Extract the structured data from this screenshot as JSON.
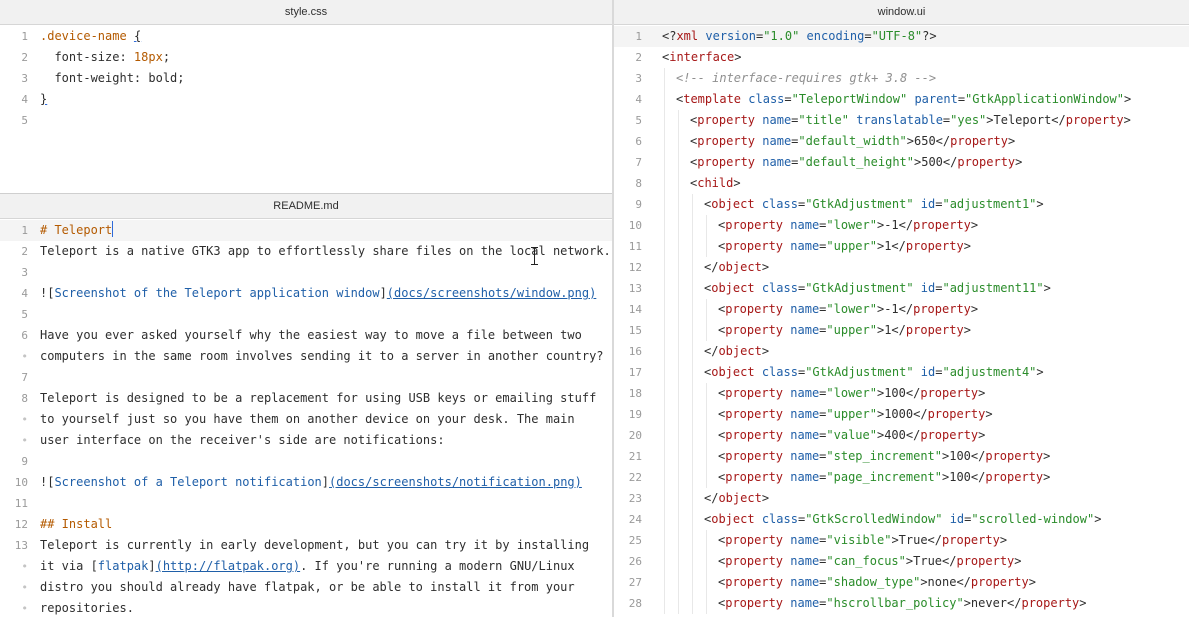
{
  "panes": {
    "css": {
      "title": "style.css"
    },
    "readme": {
      "title": "README.md"
    },
    "ui": {
      "title": "window.ui"
    }
  },
  "css_lines": [
    {
      "n": "1",
      "parts": [
        {
          "t": ".device-name",
          "c": "c-sel"
        },
        {
          "t": " "
        },
        {
          "t": "{",
          "c": "c-ul"
        }
      ]
    },
    {
      "n": "2",
      "parts": [
        {
          "t": "  font-size: "
        },
        {
          "t": "18px",
          "c": "c-num"
        },
        {
          "t": ";"
        }
      ]
    },
    {
      "n": "3",
      "parts": [
        {
          "t": "  font-weight: bold;"
        }
      ]
    },
    {
      "n": "4",
      "parts": [
        {
          "t": "}",
          "c": "c-ul"
        }
      ]
    },
    {
      "n": "5",
      "parts": [
        {
          "t": ""
        }
      ]
    }
  ],
  "readme_lines": [
    {
      "n": "1",
      "current": true,
      "caret": true,
      "parts": [
        {
          "t": "# Teleport",
          "c": "c-head"
        }
      ]
    },
    {
      "n": "2",
      "parts": [
        {
          "t": "Teleport is a native GTK3 app to effortlessly share files on the local network."
        }
      ]
    },
    {
      "n": "3",
      "parts": [
        {
          "t": ""
        }
      ]
    },
    {
      "n": "4",
      "parts": [
        {
          "t": "!["
        },
        {
          "t": "Screenshot of the Teleport application window",
          "c": "c-link"
        },
        {
          "t": "]"
        },
        {
          "t": "(docs/screenshots/window.png)",
          "c": "c-url"
        }
      ]
    },
    {
      "n": "5",
      "parts": [
        {
          "t": ""
        }
      ]
    },
    {
      "n": "6",
      "parts": [
        {
          "t": "Have you ever asked yourself why the easiest way to move a file between two"
        }
      ]
    },
    {
      "n": "•",
      "dot": true,
      "parts": [
        {
          "t": "computers in the same room involves sending it to a server in another country?"
        }
      ]
    },
    {
      "n": "7",
      "parts": [
        {
          "t": ""
        }
      ]
    },
    {
      "n": "8",
      "parts": [
        {
          "t": "Teleport is designed to be a replacement for using USB keys or emailing stuff"
        }
      ]
    },
    {
      "n": "•",
      "dot": true,
      "parts": [
        {
          "t": "to yourself just so you have them on another device on your desk. The main"
        }
      ]
    },
    {
      "n": "•",
      "dot": true,
      "parts": [
        {
          "t": "user interface on the receiver's side are notifications:"
        }
      ]
    },
    {
      "n": "9",
      "parts": [
        {
          "t": ""
        }
      ]
    },
    {
      "n": "10",
      "parts": [
        {
          "t": "!["
        },
        {
          "t": "Screenshot of a Teleport notification",
          "c": "c-link"
        },
        {
          "t": "]"
        },
        {
          "t": "(docs/screenshots/notification.png)",
          "c": "c-url"
        }
      ]
    },
    {
      "n": "11",
      "parts": [
        {
          "t": ""
        }
      ]
    },
    {
      "n": "12",
      "parts": [
        {
          "t": "## Install",
          "c": "c-head"
        }
      ]
    },
    {
      "n": "13",
      "parts": [
        {
          "t": "Teleport is currently in early development, but you can try it by installing"
        }
      ]
    },
    {
      "n": "•",
      "dot": true,
      "parts": [
        {
          "t": "it via ["
        },
        {
          "t": "flatpak",
          "c": "c-link"
        },
        {
          "t": "]"
        },
        {
          "t": "(http://flatpak.org)",
          "c": "c-url"
        },
        {
          "t": ". If you're running a modern GNU/Linux"
        }
      ]
    },
    {
      "n": "•",
      "dot": true,
      "parts": [
        {
          "t": "distro you should already have flatpak, or be able to install it from your"
        }
      ]
    },
    {
      "n": "•",
      "dot": true,
      "parts": [
        {
          "t": "repositories."
        }
      ]
    }
  ],
  "ui_lines": [
    {
      "n": "1",
      "i": 0,
      "current": true,
      "parts": [
        {
          "t": "<?"
        },
        {
          "t": "xml",
          "c": "c-tag"
        },
        {
          "t": " "
        },
        {
          "t": "version",
          "c": "c-attr"
        },
        {
          "t": "="
        },
        {
          "t": "\"1.0\"",
          "c": "c-str"
        },
        {
          "t": " "
        },
        {
          "t": "encoding",
          "c": "c-attr"
        },
        {
          "t": "="
        },
        {
          "t": "\"UTF-8\"",
          "c": "c-str"
        },
        {
          "t": "?>"
        }
      ]
    },
    {
      "n": "2",
      "i": 0,
      "parts": [
        {
          "t": "<"
        },
        {
          "t": "interface",
          "c": "c-tag"
        },
        {
          "t": ">"
        }
      ]
    },
    {
      "n": "3",
      "i": 1,
      "parts": [
        {
          "t": "<!-- interface-requires gtk+ 3.8 -->",
          "c": "c-com"
        }
      ]
    },
    {
      "n": "4",
      "i": 1,
      "parts": [
        {
          "t": "<"
        },
        {
          "t": "template",
          "c": "c-tag"
        },
        {
          "t": " "
        },
        {
          "t": "class",
          "c": "c-attr"
        },
        {
          "t": "="
        },
        {
          "t": "\"TeleportWindow\"",
          "c": "c-str"
        },
        {
          "t": " "
        },
        {
          "t": "parent",
          "c": "c-attr"
        },
        {
          "t": "="
        },
        {
          "t": "\"GtkApplicationWindow\"",
          "c": "c-str"
        },
        {
          "t": ">"
        }
      ]
    },
    {
      "n": "5",
      "i": 2,
      "parts": [
        {
          "t": "<"
        },
        {
          "t": "property",
          "c": "c-tag"
        },
        {
          "t": " "
        },
        {
          "t": "name",
          "c": "c-attr"
        },
        {
          "t": "="
        },
        {
          "t": "\"title\"",
          "c": "c-str"
        },
        {
          "t": " "
        },
        {
          "t": "translatable",
          "c": "c-attr"
        },
        {
          "t": "="
        },
        {
          "t": "\"yes\"",
          "c": "c-str"
        },
        {
          "t": ">Teleport</"
        },
        {
          "t": "property",
          "c": "c-tag"
        },
        {
          "t": ">"
        }
      ]
    },
    {
      "n": "6",
      "i": 2,
      "parts": [
        {
          "t": "<"
        },
        {
          "t": "property",
          "c": "c-tag"
        },
        {
          "t": " "
        },
        {
          "t": "name",
          "c": "c-attr"
        },
        {
          "t": "="
        },
        {
          "t": "\"default_width\"",
          "c": "c-str"
        },
        {
          "t": ">650</"
        },
        {
          "t": "property",
          "c": "c-tag"
        },
        {
          "t": ">"
        }
      ]
    },
    {
      "n": "7",
      "i": 2,
      "parts": [
        {
          "t": "<"
        },
        {
          "t": "property",
          "c": "c-tag"
        },
        {
          "t": " "
        },
        {
          "t": "name",
          "c": "c-attr"
        },
        {
          "t": "="
        },
        {
          "t": "\"default_height\"",
          "c": "c-str"
        },
        {
          "t": ">500</"
        },
        {
          "t": "property",
          "c": "c-tag"
        },
        {
          "t": ">"
        }
      ]
    },
    {
      "n": "8",
      "i": 2,
      "parts": [
        {
          "t": "<"
        },
        {
          "t": "child",
          "c": "c-tag"
        },
        {
          "t": ">"
        }
      ]
    },
    {
      "n": "9",
      "i": 3,
      "parts": [
        {
          "t": "<"
        },
        {
          "t": "object",
          "c": "c-tag"
        },
        {
          "t": " "
        },
        {
          "t": "class",
          "c": "c-attr"
        },
        {
          "t": "="
        },
        {
          "t": "\"GtkAdjustment\"",
          "c": "c-str"
        },
        {
          "t": " "
        },
        {
          "t": "id",
          "c": "c-attr"
        },
        {
          "t": "="
        },
        {
          "t": "\"adjustment1\"",
          "c": "c-str"
        },
        {
          "t": ">"
        }
      ]
    },
    {
      "n": "10",
      "i": 4,
      "parts": [
        {
          "t": "<"
        },
        {
          "t": "property",
          "c": "c-tag"
        },
        {
          "t": " "
        },
        {
          "t": "name",
          "c": "c-attr"
        },
        {
          "t": "="
        },
        {
          "t": "\"lower\"",
          "c": "c-str"
        },
        {
          "t": ">-1</"
        },
        {
          "t": "property",
          "c": "c-tag"
        },
        {
          "t": ">"
        }
      ]
    },
    {
      "n": "11",
      "i": 4,
      "parts": [
        {
          "t": "<"
        },
        {
          "t": "property",
          "c": "c-tag"
        },
        {
          "t": " "
        },
        {
          "t": "name",
          "c": "c-attr"
        },
        {
          "t": "="
        },
        {
          "t": "\"upper\"",
          "c": "c-str"
        },
        {
          "t": ">1</"
        },
        {
          "t": "property",
          "c": "c-tag"
        },
        {
          "t": ">"
        }
      ]
    },
    {
      "n": "12",
      "i": 3,
      "parts": [
        {
          "t": "</"
        },
        {
          "t": "object",
          "c": "c-tag"
        },
        {
          "t": ">"
        }
      ]
    },
    {
      "n": "13",
      "i": 3,
      "parts": [
        {
          "t": "<"
        },
        {
          "t": "object",
          "c": "c-tag"
        },
        {
          "t": " "
        },
        {
          "t": "class",
          "c": "c-attr"
        },
        {
          "t": "="
        },
        {
          "t": "\"GtkAdjustment\"",
          "c": "c-str"
        },
        {
          "t": " "
        },
        {
          "t": "id",
          "c": "c-attr"
        },
        {
          "t": "="
        },
        {
          "t": "\"adjustment11\"",
          "c": "c-str"
        },
        {
          "t": ">"
        }
      ]
    },
    {
      "n": "14",
      "i": 4,
      "parts": [
        {
          "t": "<"
        },
        {
          "t": "property",
          "c": "c-tag"
        },
        {
          "t": " "
        },
        {
          "t": "name",
          "c": "c-attr"
        },
        {
          "t": "="
        },
        {
          "t": "\"lower\"",
          "c": "c-str"
        },
        {
          "t": ">-1</"
        },
        {
          "t": "property",
          "c": "c-tag"
        },
        {
          "t": ">"
        }
      ]
    },
    {
      "n": "15",
      "i": 4,
      "parts": [
        {
          "t": "<"
        },
        {
          "t": "property",
          "c": "c-tag"
        },
        {
          "t": " "
        },
        {
          "t": "name",
          "c": "c-attr"
        },
        {
          "t": "="
        },
        {
          "t": "\"upper\"",
          "c": "c-str"
        },
        {
          "t": ">1</"
        },
        {
          "t": "property",
          "c": "c-tag"
        },
        {
          "t": ">"
        }
      ]
    },
    {
      "n": "16",
      "i": 3,
      "parts": [
        {
          "t": "</"
        },
        {
          "t": "object",
          "c": "c-tag"
        },
        {
          "t": ">"
        }
      ]
    },
    {
      "n": "17",
      "i": 3,
      "parts": [
        {
          "t": "<"
        },
        {
          "t": "object",
          "c": "c-tag"
        },
        {
          "t": " "
        },
        {
          "t": "class",
          "c": "c-attr"
        },
        {
          "t": "="
        },
        {
          "t": "\"GtkAdjustment\"",
          "c": "c-str"
        },
        {
          "t": " "
        },
        {
          "t": "id",
          "c": "c-attr"
        },
        {
          "t": "="
        },
        {
          "t": "\"adjustment4\"",
          "c": "c-str"
        },
        {
          "t": ">"
        }
      ]
    },
    {
      "n": "18",
      "i": 4,
      "parts": [
        {
          "t": "<"
        },
        {
          "t": "property",
          "c": "c-tag"
        },
        {
          "t": " "
        },
        {
          "t": "name",
          "c": "c-attr"
        },
        {
          "t": "="
        },
        {
          "t": "\"lower\"",
          "c": "c-str"
        },
        {
          "t": ">100</"
        },
        {
          "t": "property",
          "c": "c-tag"
        },
        {
          "t": ">"
        }
      ]
    },
    {
      "n": "19",
      "i": 4,
      "parts": [
        {
          "t": "<"
        },
        {
          "t": "property",
          "c": "c-tag"
        },
        {
          "t": " "
        },
        {
          "t": "name",
          "c": "c-attr"
        },
        {
          "t": "="
        },
        {
          "t": "\"upper\"",
          "c": "c-str"
        },
        {
          "t": ">1000</"
        },
        {
          "t": "property",
          "c": "c-tag"
        },
        {
          "t": ">"
        }
      ]
    },
    {
      "n": "20",
      "i": 4,
      "parts": [
        {
          "t": "<"
        },
        {
          "t": "property",
          "c": "c-tag"
        },
        {
          "t": " "
        },
        {
          "t": "name",
          "c": "c-attr"
        },
        {
          "t": "="
        },
        {
          "t": "\"value\"",
          "c": "c-str"
        },
        {
          "t": ">400</"
        },
        {
          "t": "property",
          "c": "c-tag"
        },
        {
          "t": ">"
        }
      ]
    },
    {
      "n": "21",
      "i": 4,
      "parts": [
        {
          "t": "<"
        },
        {
          "t": "property",
          "c": "c-tag"
        },
        {
          "t": " "
        },
        {
          "t": "name",
          "c": "c-attr"
        },
        {
          "t": "="
        },
        {
          "t": "\"step_increment\"",
          "c": "c-str"
        },
        {
          "t": ">100</"
        },
        {
          "t": "property",
          "c": "c-tag"
        },
        {
          "t": ">"
        }
      ]
    },
    {
      "n": "22",
      "i": 4,
      "parts": [
        {
          "t": "<"
        },
        {
          "t": "property",
          "c": "c-tag"
        },
        {
          "t": " "
        },
        {
          "t": "name",
          "c": "c-attr"
        },
        {
          "t": "="
        },
        {
          "t": "\"page_increment\"",
          "c": "c-str"
        },
        {
          "t": ">100</"
        },
        {
          "t": "property",
          "c": "c-tag"
        },
        {
          "t": ">"
        }
      ]
    },
    {
      "n": "23",
      "i": 3,
      "parts": [
        {
          "t": "</"
        },
        {
          "t": "object",
          "c": "c-tag"
        },
        {
          "t": ">"
        }
      ]
    },
    {
      "n": "24",
      "i": 3,
      "parts": [
        {
          "t": "<"
        },
        {
          "t": "object",
          "c": "c-tag"
        },
        {
          "t": " "
        },
        {
          "t": "class",
          "c": "c-attr"
        },
        {
          "t": "="
        },
        {
          "t": "\"GtkScrolledWindow\"",
          "c": "c-str"
        },
        {
          "t": " "
        },
        {
          "t": "id",
          "c": "c-attr"
        },
        {
          "t": "="
        },
        {
          "t": "\"scrolled-window\"",
          "c": "c-str"
        },
        {
          "t": ">"
        }
      ]
    },
    {
      "n": "25",
      "i": 4,
      "parts": [
        {
          "t": "<"
        },
        {
          "t": "property",
          "c": "c-tag"
        },
        {
          "t": " "
        },
        {
          "t": "name",
          "c": "c-attr"
        },
        {
          "t": "="
        },
        {
          "t": "\"visible\"",
          "c": "c-str"
        },
        {
          "t": ">True</"
        },
        {
          "t": "property",
          "c": "c-tag"
        },
        {
          "t": ">"
        }
      ]
    },
    {
      "n": "26",
      "i": 4,
      "parts": [
        {
          "t": "<"
        },
        {
          "t": "property",
          "c": "c-tag"
        },
        {
          "t": " "
        },
        {
          "t": "name",
          "c": "c-attr"
        },
        {
          "t": "="
        },
        {
          "t": "\"can_focus\"",
          "c": "c-str"
        },
        {
          "t": ">True</"
        },
        {
          "t": "property",
          "c": "c-tag"
        },
        {
          "t": ">"
        }
      ]
    },
    {
      "n": "27",
      "i": 4,
      "parts": [
        {
          "t": "<"
        },
        {
          "t": "property",
          "c": "c-tag"
        },
        {
          "t": " "
        },
        {
          "t": "name",
          "c": "c-attr"
        },
        {
          "t": "="
        },
        {
          "t": "\"shadow_type\"",
          "c": "c-str"
        },
        {
          "t": ">none</"
        },
        {
          "t": "property",
          "c": "c-tag"
        },
        {
          "t": ">"
        }
      ]
    },
    {
      "n": "28",
      "i": 4,
      "parts": [
        {
          "t": "<"
        },
        {
          "t": "property",
          "c": "c-tag"
        },
        {
          "t": " "
        },
        {
          "t": "name",
          "c": "c-attr"
        },
        {
          "t": "="
        },
        {
          "t": "\"hscrollbar_policy\"",
          "c": "c-str"
        },
        {
          "t": ">never</"
        },
        {
          "t": "property",
          "c": "c-tag"
        },
        {
          "t": ">"
        }
      ]
    }
  ]
}
